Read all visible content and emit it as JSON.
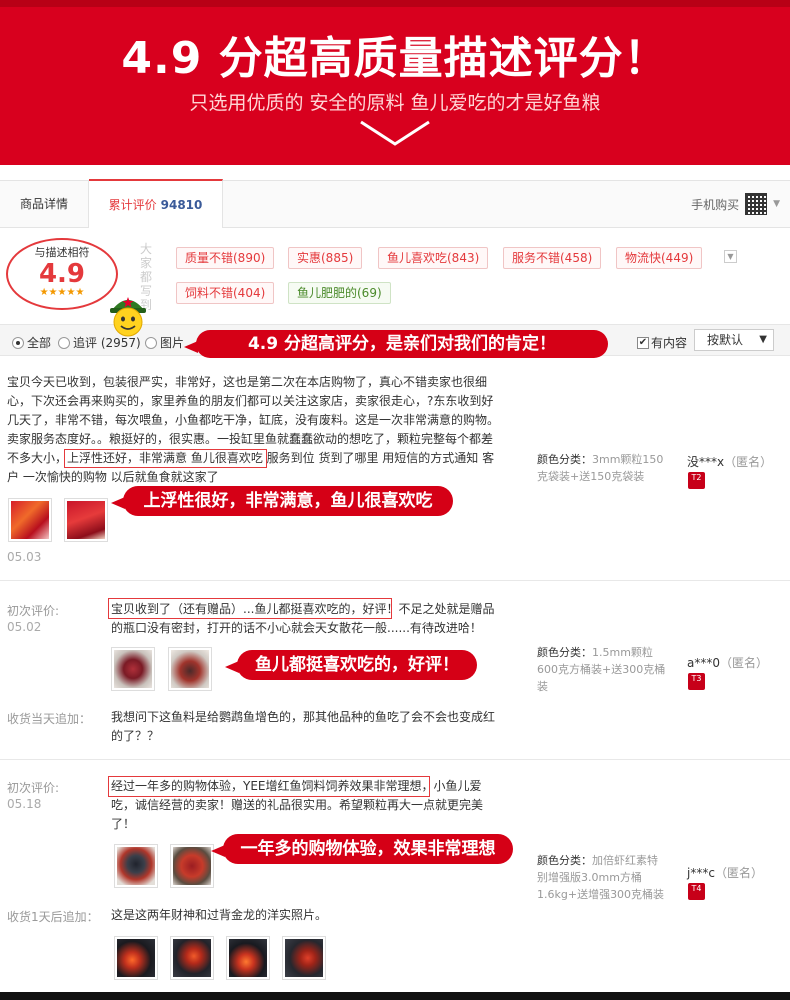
{
  "banner": {
    "title": "4.9 分超高质量描述评分！",
    "subtitle": "只选用优质的 安全的原料 鱼儿爱吃的才是好鱼粮"
  },
  "tabs": {
    "details": "商品详情",
    "reviews_label": "累计评价",
    "reviews_count": "94810",
    "mobile_buy": "手机购买"
  },
  "summary": {
    "label": "与描述相符",
    "score": "4.9",
    "stars": "★★★★★",
    "impressions_label": "大家都写到"
  },
  "tags": [
    "质量不错(890)",
    "实惠(885)",
    "鱼儿喜欢吃(843)",
    "服务不错(458)",
    "物流快(449)",
    "饲料不错(404)",
    "鱼儿肥肥的(69)"
  ],
  "filter": {
    "all": "全部",
    "followup": "追评 (2957)",
    "pictures": "图片",
    "has_content": "有内容",
    "sort": "按默认"
  },
  "callouts": {
    "top": "4.9 分超高评分，是亲们对我们的肯定！",
    "r1": "上浮性很好，非常满意，鱼儿很喜欢吃",
    "r2": "鱼儿都挺喜欢吃的，好评！",
    "r3": "一年多的购物体验，效果非常理想"
  },
  "reviews": [
    {
      "lines": [
        "宝贝今天已收到，包装很严实，非常好，这也是第二次在本店购物了，真心不错卖家也很细",
        "心，下次还会再来购买的，家里养鱼的朋友们都可以关注这家店，卖家很走心，?东东收到好",
        "几天了，非常不错，每次喂鱼，小鱼都吃干净，缸底，没有废料。这是一次非常满意的购物。",
        "卖家服务态度好。。粮挺好的，很实惠。一投缸里鱼就蠢蠢欲动的想吃了，颗粒完整每个都差",
        "不多大小，上浮性还好，非常满意 鱼儿很喜欢吃 服务到位 货到了哪里 用短信的方式通知 客",
        "户 一次愉快的购物 以后就鱼食就这家了"
      ],
      "date": "05.03",
      "sku_label": "颜色分类：",
      "sku": [
        "3mm颗粒150",
        "克袋装+送150克袋装"
      ],
      "user": "没***x",
      "anon": "（匿名）",
      "level": "T2"
    },
    {
      "first_label": "初次评价:",
      "date": "05.02",
      "lines": [
        "宝贝收到了（还有赠品）...鱼儿都挺喜欢吃的，好评！不足之处就是赠品",
        "的瓶口没有密封，打开的话不小心就会天女散花一般......有待改进哈！"
      ],
      "followup_label": "收货当天追加：",
      "followup": [
        "我想问下这鱼料是给鹦鹉鱼增色的，那其他品种的鱼吃了会不会也变成红",
        "的了？？"
      ],
      "sku_label": "颜色分类：",
      "sku": [
        "1.5mm颗粒",
        "600克方桶装+送300克桶",
        "装"
      ],
      "user": "a***0",
      "anon": "（匿名）",
      "level": "T3"
    },
    {
      "first_label": "初次评价:",
      "date": "05.18",
      "lines": [
        "经过一年多的购物体验，YEE增红鱼饲料饲养效果非常理想，小鱼儿爱",
        "吃，诚信经营的卖家！赠送的礼品很实用。希望颗粒再大一点就更完美",
        "了！"
      ],
      "followup_label": "收货1天后追加：",
      "followup": [
        "这是这两年财神和过背金龙的洋实照片。"
      ],
      "sku_label": "颜色分类：",
      "sku": [
        "加倍虾红素特",
        "别增强版3.0mm方桶",
        "1.6kg+送增强300克桶装"
      ],
      "user": "j***c",
      "anon": "（匿名）",
      "level": "T4"
    }
  ],
  "colors": {
    "brand_red": "#d8001e",
    "tag_red": "#e4393c",
    "link_blue": "#3a5a99"
  }
}
